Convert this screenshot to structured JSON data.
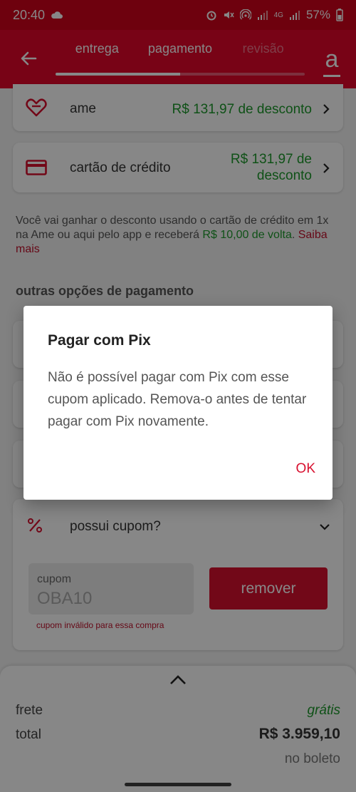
{
  "status_bar": {
    "time": "20:40",
    "battery": "57%",
    "network": "4G"
  },
  "header": {
    "tabs": [
      {
        "label": "entrega"
      },
      {
        "label": "pagamento"
      },
      {
        "label": "revisão"
      }
    ],
    "progress_fraction": 0.5,
    "logo_letter": "a"
  },
  "payments": {
    "ame": {
      "label": "ame",
      "discount": "R$ 131,97 de desconto"
    },
    "credit_card": {
      "label": "cartão de crédito",
      "discount_line1": "R$ 131,97 de",
      "discount_line2": "desconto"
    }
  },
  "info": {
    "text": "Você vai ganhar o desconto usando o cartão de crédito em 1x na Ame ou aqui pelo app e receberá ",
    "cashback": "R$ 10,00 de volta",
    "dot": ". ",
    "link": "Saiba mais"
  },
  "other_options_title": "outras opções de pagamento",
  "coupon": {
    "question": "possui cupom?",
    "field_label": "cupom",
    "field_value": "OBA10",
    "remove_label": "remover",
    "error": "cupom inválido para essa compra"
  },
  "summary": {
    "shipping_label": "frete",
    "shipping_value": "grátis",
    "total_label": "total",
    "total_value": "R$ 3.959,10",
    "payment_method": "no boleto"
  },
  "dialog": {
    "title": "Pagar com Pix",
    "message": "Não é possível pagar com Pix com esse cupom aplicado. Remova-o antes de tentar pagar com Pix novamente.",
    "ok_label": "OK"
  },
  "colors": {
    "brand_red": "#e3062b",
    "discount_green": "#1e9a2c"
  }
}
